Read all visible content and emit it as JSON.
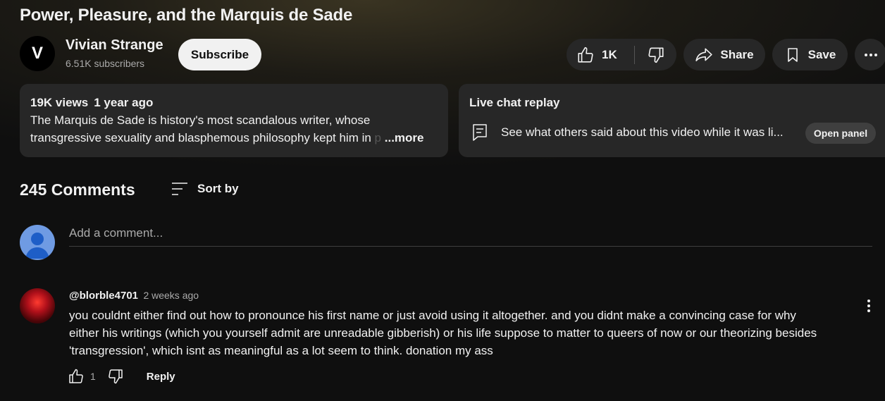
{
  "video": {
    "title": "Power, Pleasure, and the Marquis de Sade"
  },
  "channel": {
    "avatar_letter": "V",
    "name": "Vivian Strange",
    "subscribers": "6.51K subscribers",
    "subscribe_label": "Subscribe"
  },
  "actions": {
    "likes": "1K",
    "share_label": "Share",
    "save_label": "Save",
    "icons": [
      "thumb-up-icon",
      "thumb-down-icon",
      "share-icon",
      "bookmark-icon",
      "more-horizontal-icon"
    ]
  },
  "description": {
    "views": "19K views",
    "age": "1 year ago",
    "line1": "The Marquis de Sade is history's most scandalous writer, whose",
    "line2": "transgressive sexuality and blasphemous philosophy kept him in ",
    "line2_fade": "p",
    "more_label": "...more"
  },
  "live_chat": {
    "header": "Live chat replay",
    "text": "See what others said about this video while it was li...",
    "button_label": "Open panel"
  },
  "comments_section": {
    "count_label": "245 Comments",
    "sort_label": "Sort by",
    "add_placeholder": "Add a comment..."
  },
  "comments": [
    {
      "author": "@blorble4701",
      "time": "2 weeks ago",
      "lines": [
        "you couldnt either find out how to pronounce his first name or just avoid using it altogether. and you didnt make a convincing case for why",
        "either his writings (which you yourself admit are unreadable gibberish) or his life suppose to matter to queers of now or our theorizing besides",
        "'transgression', which isnt as meaningful as a lot seem to think. donation my ass"
      ],
      "likes": "1",
      "reply_label": "Reply"
    }
  ],
  "colors": {
    "background": "#0f0f0f",
    "surface": "#272727",
    "text_primary": "#f1f1f1",
    "text_secondary": "#aaaaaa"
  }
}
